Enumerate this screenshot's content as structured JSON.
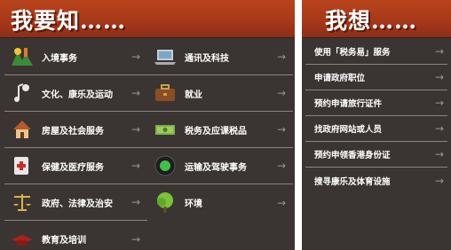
{
  "left_panel": {
    "title": "我要知……",
    "column_a": [
      {
        "label": "入境事务",
        "icon": "immigration-icon",
        "arrow": "→"
      },
      {
        "label": "文化、康乐及运动",
        "icon": "culture-sports-icon",
        "arrow": "→"
      },
      {
        "label": "房屋及社会服务",
        "icon": "house-icon",
        "arrow": "→"
      },
      {
        "label": "保健及医疗服务",
        "icon": "first-aid-icon",
        "arrow": "→"
      },
      {
        "label": "政府、法律及治安",
        "icon": "scales-icon",
        "arrow": "→"
      },
      {
        "label": "教育及培训",
        "icon": "graduation-cap-icon",
        "arrow": "→"
      }
    ],
    "column_b": [
      {
        "label": "通讯及科技",
        "icon": "laptop-icon",
        "arrow": "→"
      },
      {
        "label": "就业",
        "icon": "briefcase-icon",
        "arrow": "→"
      },
      {
        "label": "税务及应课税品",
        "icon": "money-icon",
        "arrow": "→"
      },
      {
        "label": "运输及驾驶事务",
        "icon": "traffic-light-icon",
        "arrow": "→"
      },
      {
        "label": "环境",
        "icon": "tree-icon",
        "arrow": "→"
      }
    ]
  },
  "right_panel": {
    "title": "我想……",
    "items": [
      {
        "label": "使用「税务易」服务",
        "arrow": "→"
      },
      {
        "label": "申请政府职位",
        "arrow": "→"
      },
      {
        "label": "预约申请旅行证件",
        "arrow": "→"
      },
      {
        "label": "找政府网站或人员",
        "arrow": "→"
      },
      {
        "label": "预约申领香港身份证",
        "arrow": "→"
      },
      {
        "label": "搜寻康乐及体育设施",
        "arrow": "→"
      }
    ]
  }
}
